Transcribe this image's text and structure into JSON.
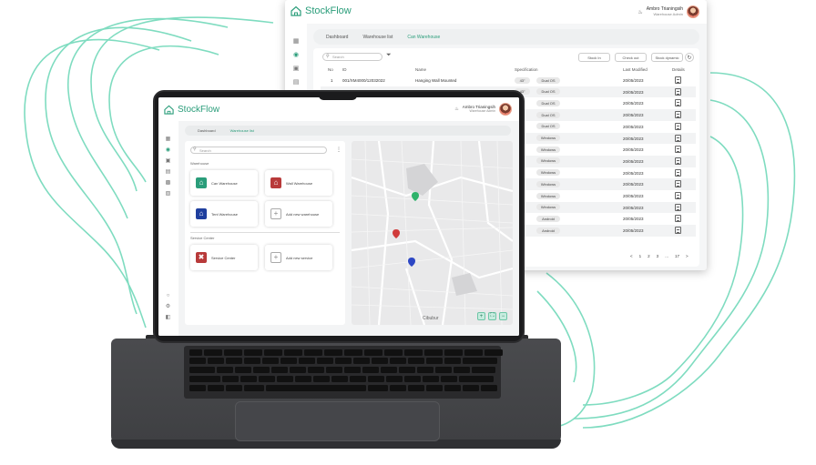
{
  "colors": {
    "accent": "#2a9d7a",
    "swirl": "#7fdcc0",
    "laptop": "#3e3f42"
  },
  "app": {
    "brand": "StockFlow"
  },
  "user": {
    "name": "Ambro Trianingsih",
    "role": "Warehouse Admin"
  },
  "back_window": {
    "breadcrumb": [
      "Dashboard",
      "Warehouse list",
      "Can Warehouse"
    ],
    "search_placeholder": "Search",
    "buttons": {
      "stock_in": "Stock In",
      "check_out": "Check out",
      "stock_dynamic": "Stock dynamic"
    },
    "table": {
      "headers": [
        "No",
        "ID",
        "Name",
        "Specification",
        "Last Modified",
        "Details"
      ],
      "rows": [
        {
          "no": "1",
          "id": "001/XM4000/12032022",
          "name": "Hanging Wall Mounted",
          "size": "43\"",
          "os": "Dual OS",
          "date": "20/05/2023"
        },
        {
          "no": "",
          "id": "",
          "name": "",
          "size": "43\"",
          "os": "Dual OS",
          "date": "20/05/2023"
        },
        {
          "no": "",
          "id": "",
          "name": "",
          "size": "",
          "os": "Dual OS",
          "date": "20/05/2023"
        },
        {
          "no": "",
          "id": "",
          "name": "",
          "size": "",
          "os": "Dual OS",
          "date": "20/05/2023"
        },
        {
          "no": "",
          "id": "",
          "name": "",
          "size": "",
          "os": "Dual OS",
          "date": "20/05/2023"
        },
        {
          "no": "",
          "id": "",
          "name": "",
          "size": "",
          "os": "Windows",
          "date": "20/05/2023"
        },
        {
          "no": "",
          "id": "",
          "name": "",
          "size": "",
          "os": "Windows",
          "date": "20/05/2023"
        },
        {
          "no": "",
          "id": "",
          "name": "",
          "size": "",
          "os": "Windows",
          "date": "20/05/2023"
        },
        {
          "no": "",
          "id": "",
          "name": "",
          "size": "",
          "os": "Windows",
          "date": "20/05/2023"
        },
        {
          "no": "",
          "id": "",
          "name": "",
          "size": "",
          "os": "Windows",
          "date": "20/05/2023"
        },
        {
          "no": "",
          "id": "",
          "name": "",
          "size": "",
          "os": "Windows",
          "date": "20/05/2023"
        },
        {
          "no": "",
          "id": "",
          "name": "",
          "size": "",
          "os": "Windows",
          "date": "20/05/2023"
        },
        {
          "no": "",
          "id": "",
          "name": "",
          "size": "",
          "os": "Android",
          "date": "20/05/2023"
        },
        {
          "no": "",
          "id": "",
          "name": "",
          "size": "",
          "os": "Android",
          "date": "20/05/2023"
        }
      ]
    },
    "pagination": [
      "<",
      "1",
      "2",
      "3",
      "...",
      "17",
      ">"
    ]
  },
  "laptop_screen": {
    "breadcrumb": [
      "Dashboard",
      "Warehouse list"
    ],
    "search_placeholder": "Search",
    "warehouse_label": "Warehouse",
    "service_label": "Service Center",
    "cards": {
      "can": "Can Warehouse",
      "wall": "Wall Warehouse",
      "tent": "Tent Warehouse",
      "add_warehouse": "Add new warehouse",
      "service_center": "Service Center",
      "add_service": "Add new service"
    },
    "map_city": "Cibubur"
  }
}
